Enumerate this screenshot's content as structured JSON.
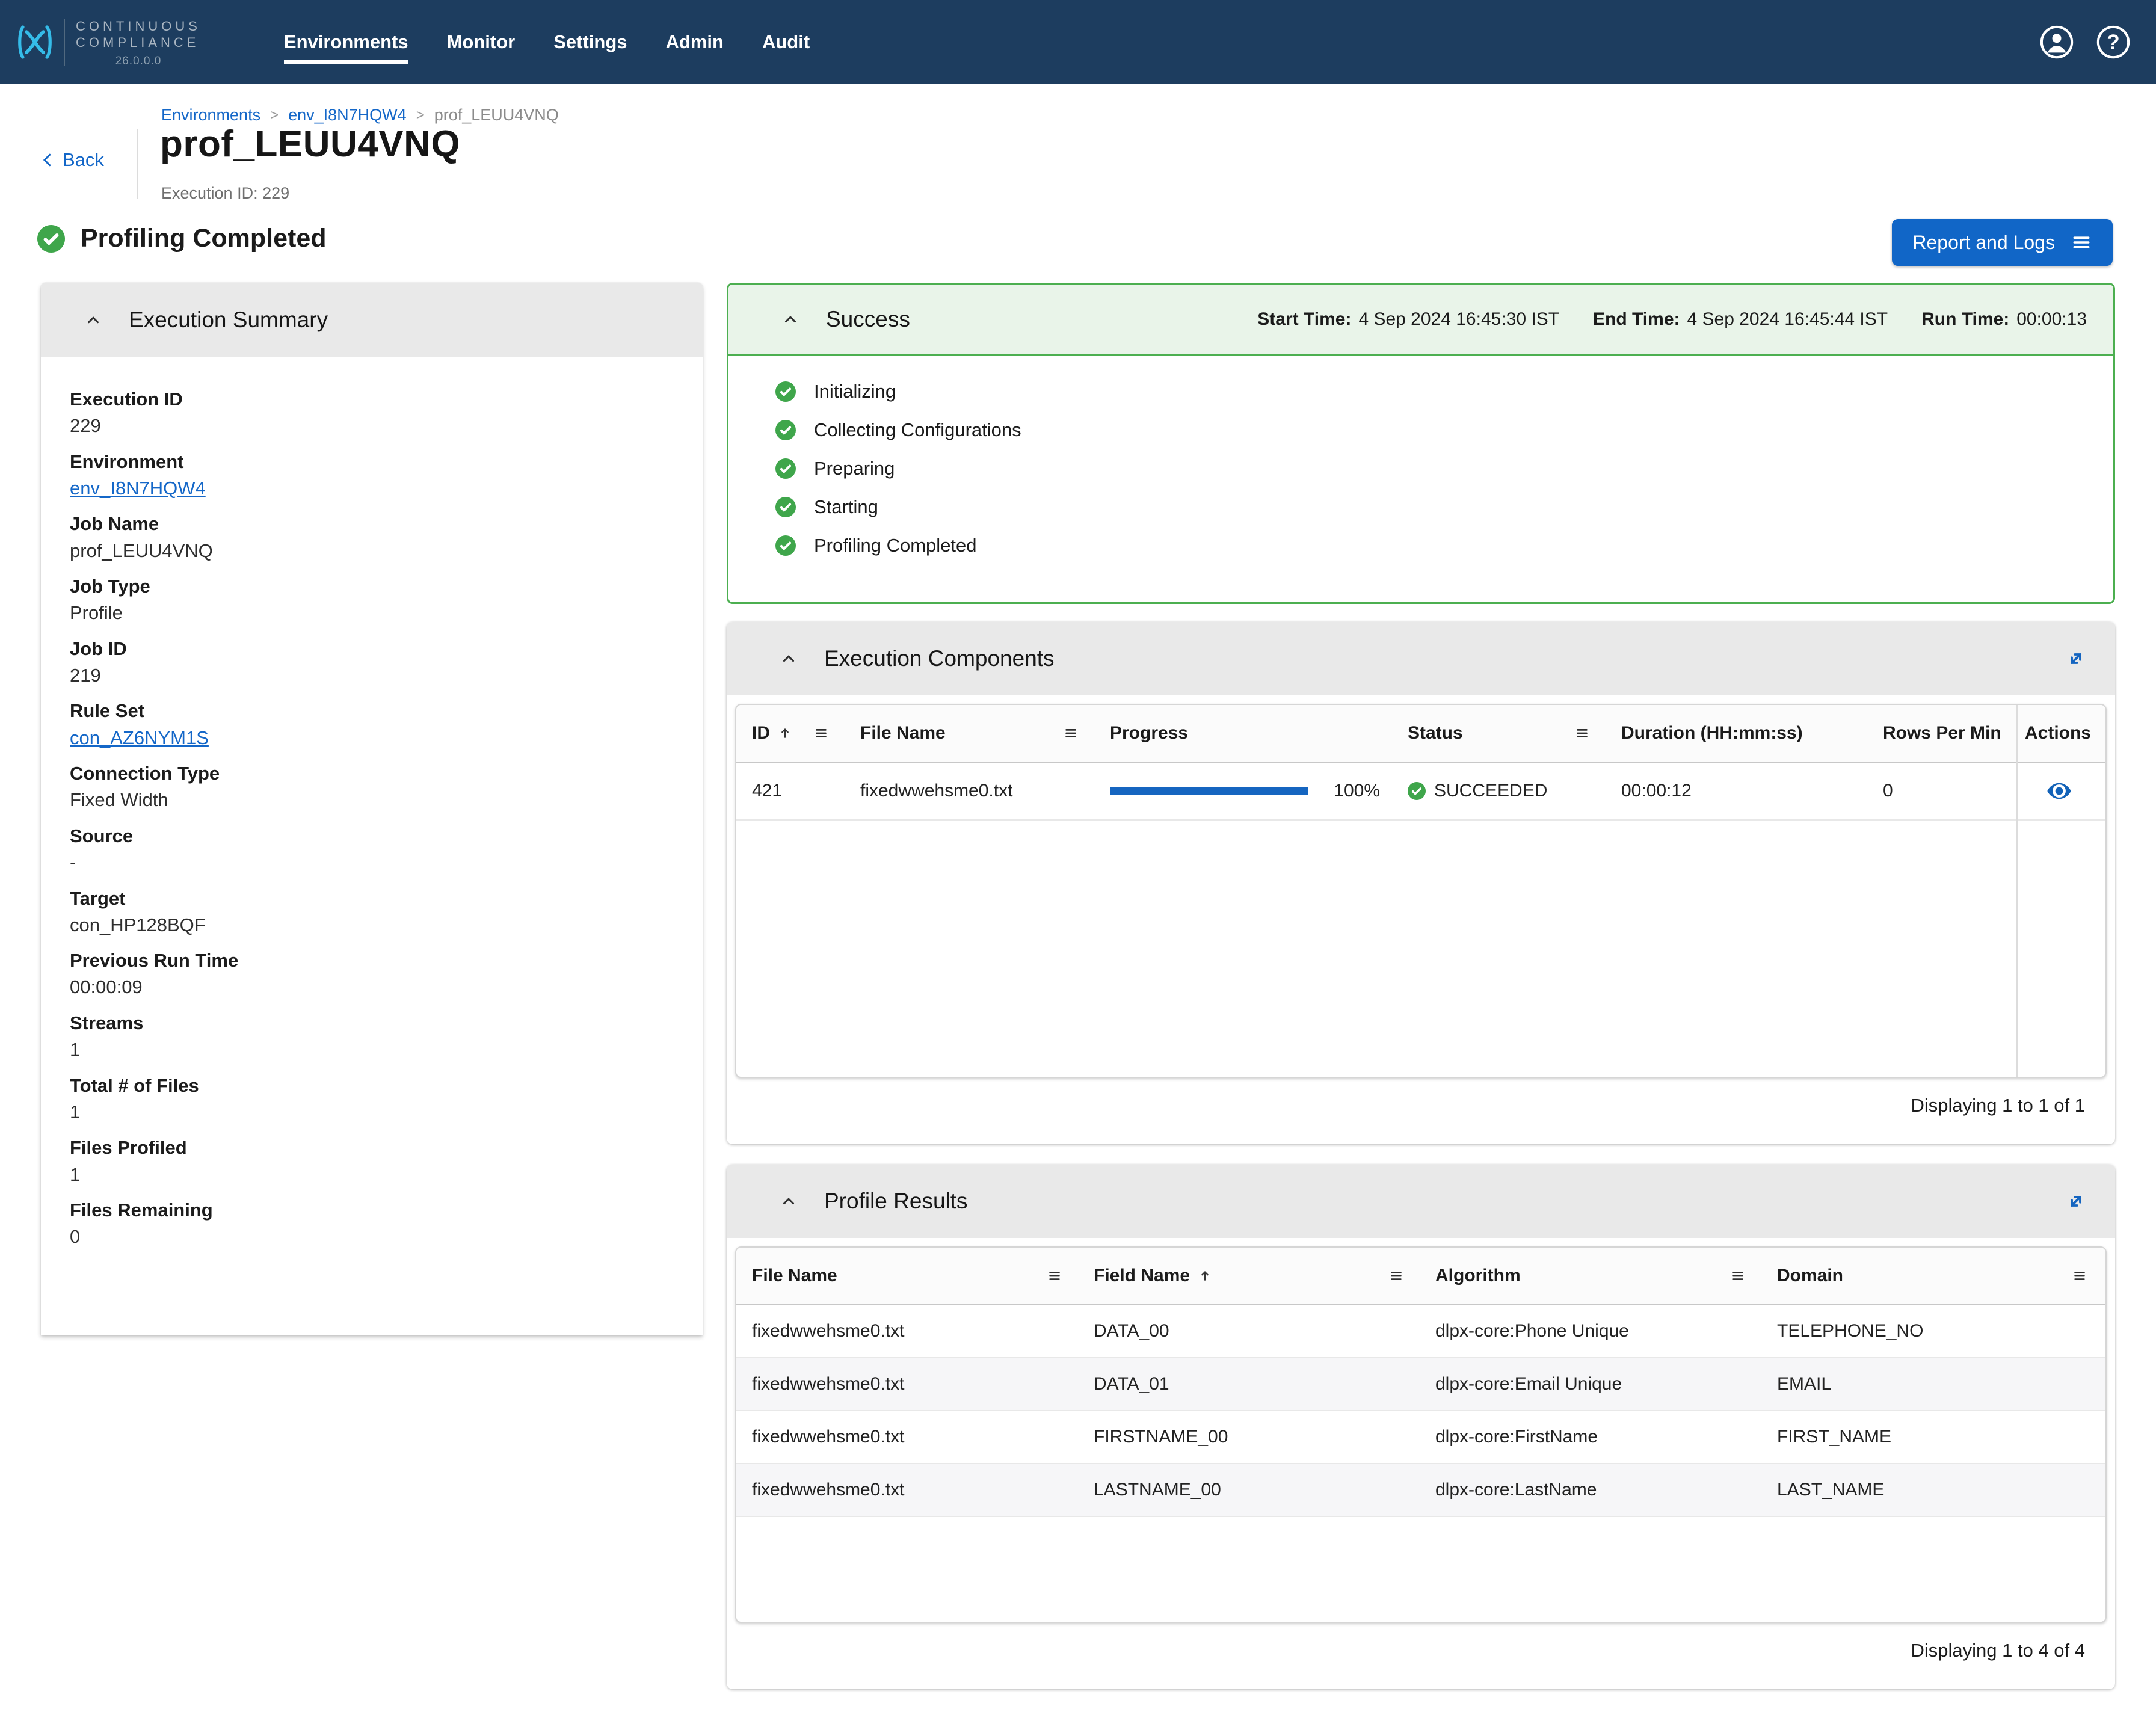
{
  "navbar": {
    "brand": {
      "line1": "CONTINUOUS",
      "line2": "COMPLIANCE",
      "version": "26.0.0.0"
    },
    "items": [
      {
        "label": "Environments"
      },
      {
        "label": "Monitor"
      },
      {
        "label": "Settings"
      },
      {
        "label": "Admin"
      },
      {
        "label": "Audit"
      }
    ]
  },
  "breadcrumb": {
    "separator": ">",
    "items": [
      {
        "label": "Environments"
      },
      {
        "label": "env_I8N7HQW4"
      },
      {
        "label": "prof_LEUU4VNQ"
      }
    ]
  },
  "header": {
    "back_label": "Back",
    "title": "prof_LEUU4VNQ",
    "execution_id": "Execution ID: 229",
    "status": "Profiling Completed",
    "report_button": "Report and Logs"
  },
  "execution_summary": {
    "title": "Execution Summary",
    "fields": [
      {
        "label": "Execution ID",
        "value": "229"
      },
      {
        "label": "Environment",
        "value": "env_I8N7HQW4"
      },
      {
        "label": "Job Name",
        "value": "prof_LEUU4VNQ"
      },
      {
        "label": "Job Type",
        "value": "Profile"
      },
      {
        "label": "Job ID",
        "value": "219"
      },
      {
        "label": "Rule Set",
        "value": "con_AZ6NYM1S"
      },
      {
        "label": "Connection Type",
        "value": "Fixed Width"
      },
      {
        "label": "Source",
        "value": "-"
      },
      {
        "label": "Target",
        "value": "con_HP128BQF"
      },
      {
        "label": "Previous Run Time",
        "value": "00:00:09"
      },
      {
        "label": "Streams",
        "value": "1"
      },
      {
        "label": "Total # of Files",
        "value": "1"
      },
      {
        "label": "Files Profiled",
        "value": "1"
      },
      {
        "label": "Files Remaining",
        "value": "0"
      }
    ]
  },
  "success_panel": {
    "title": "Success",
    "start_label": "Start Time:",
    "start_value": "4 Sep 2024 16:45:30 IST",
    "end_label": "End Time:",
    "end_value": "4 Sep 2024 16:45:44 IST",
    "run_label": "Run Time:",
    "run_value": "00:00:13",
    "steps": [
      "Initializing",
      "Collecting Configurations",
      "Preparing",
      "Starting",
      "Profiling Completed"
    ]
  },
  "execution_components": {
    "title": "Execution Components",
    "columns": {
      "id": "ID",
      "file_name": "File Name",
      "progress": "Progress",
      "status": "Status",
      "duration": "Duration (HH:mm:ss)",
      "rows_per_min": "Rows Per Min",
      "actions": "Actions"
    },
    "row": {
      "id": "421",
      "file": "fixedwwehsme0.txt",
      "progress": "100%",
      "status": "SUCCEEDED",
      "duration": "00:00:12",
      "rows_per_min": "0"
    },
    "footer": "Displaying 1 to 1 of 1"
  },
  "profile_results": {
    "title": "Profile Results",
    "columns": {
      "file_name": "File Name",
      "field_name": "Field Name",
      "algorithm": "Algorithm",
      "domain": "Domain"
    },
    "rows": [
      [
        "fixedwwehsme0.txt",
        "DATA_00",
        "dlpx-core:Phone Unique",
        "TELEPHONE_NO"
      ],
      [
        "fixedwwehsme0.txt",
        "DATA_01",
        "dlpx-core:Email Unique",
        "EMAIL"
      ],
      [
        "fixedwwehsme0.txt",
        "FIRSTNAME_00",
        "dlpx-core:FirstName",
        "FIRST_NAME"
      ],
      [
        "fixedwwehsme0.txt",
        "LASTNAME_00",
        "dlpx-core:LastName",
        "LAST_NAME"
      ]
    ],
    "footer": "Displaying 1 to 4 of 4"
  },
  "colors": {
    "navbar": "#1D3D5F",
    "accent_blue": "#1467C8",
    "success_green": "#3FA64B",
    "panel_green_bg": "#E9F4E9",
    "header_gray": "#E9E9E9"
  }
}
